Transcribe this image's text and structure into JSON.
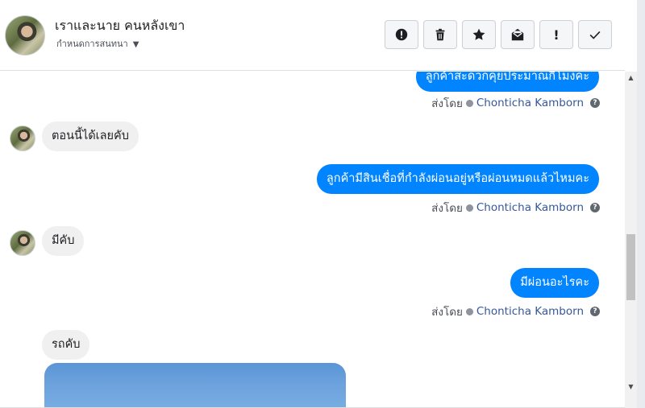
{
  "header": {
    "name": "เราและนาย คนหลังเขา",
    "subtitle": "กำหนดการสนทนา",
    "toolbar": [
      {
        "icon": "alert-circle-icon"
      },
      {
        "icon": "trash-icon"
      },
      {
        "icon": "star-icon"
      },
      {
        "icon": "mark-unread-icon"
      },
      {
        "icon": "exclamation-icon",
        "label": "!"
      },
      {
        "icon": "checkmark-icon"
      }
    ]
  },
  "messages": [
    {
      "dir": "out",
      "text": "ลูกค้าสะดวกคุยประมาณกี่โมงคะ",
      "sent_by": "ส่งโดย",
      "agent": "Chonticha Kamborn"
    },
    {
      "dir": "in",
      "text": "ตอนนี้ได้เลยคับ"
    },
    {
      "dir": "out",
      "text": "ลูกค้ามีสินเชื่อที่กำลังผ่อนอยู่หรือผ่อนหมดแล้วไหมคะ",
      "sent_by": "ส่งโดย",
      "agent": "Chonticha Kamborn"
    },
    {
      "dir": "in",
      "text": "มีคับ"
    },
    {
      "dir": "out",
      "text": "มีผ่อนอะไรคะ",
      "sent_by": "ส่งโดย",
      "agent": "Chonticha Kamborn"
    },
    {
      "dir": "in",
      "text": "รถคับ"
    }
  ],
  "colors": {
    "outgoing_bubble": "#0084ff",
    "incoming_bubble": "#f1f0f0",
    "agent_link": "#365899"
  }
}
